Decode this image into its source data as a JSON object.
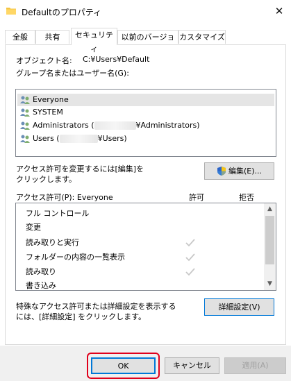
{
  "window": {
    "title": "Defaultのプロパティ",
    "close_glyph": "✕"
  },
  "tabs": [
    {
      "label": "全般"
    },
    {
      "label": "共有"
    },
    {
      "label": "セキュリティ"
    },
    {
      "label": "以前のバージョン"
    },
    {
      "label": "カスタマイズ"
    }
  ],
  "object": {
    "label": "オブジェクト名:",
    "value": "C:¥Users¥Default"
  },
  "groups": {
    "label": "グループ名またはユーザー名(G):",
    "items": [
      {
        "name": "Everyone"
      },
      {
        "name": "SYSTEM"
      },
      {
        "prefix": "Administrators (",
        "suffix": "¥Administrators)"
      },
      {
        "prefix": "Users (",
        "suffix": "¥Users)"
      }
    ]
  },
  "edit": {
    "text1": "アクセス許可を変更するには[編集]を",
    "text2": "クリックします。",
    "button": "編集(E)..."
  },
  "permissions": {
    "header": "アクセス許可(P): Everyone",
    "allow": "許可",
    "deny": "拒否",
    "rows": [
      {
        "label": "フル コントロール",
        "allow": false
      },
      {
        "label": "変更",
        "allow": false
      },
      {
        "label": "読み取りと実行",
        "allow": true
      },
      {
        "label": "フォルダーの内容の一覧表示",
        "allow": true
      },
      {
        "label": "読み取り",
        "allow": true
      },
      {
        "label": "書き込み",
        "allow": false
      }
    ]
  },
  "advanced": {
    "text1": "特殊なアクセス許可または詳細設定を表示する",
    "text2": "には、[詳細設定] をクリックします。",
    "button": "詳細設定(V)"
  },
  "footer": {
    "ok": "OK",
    "cancel": "キャンセル",
    "apply": "適用(A)"
  },
  "colors": {
    "highlight": "#e0001b",
    "selection": "#e5e5e5",
    "check": "#c8c8c8"
  }
}
